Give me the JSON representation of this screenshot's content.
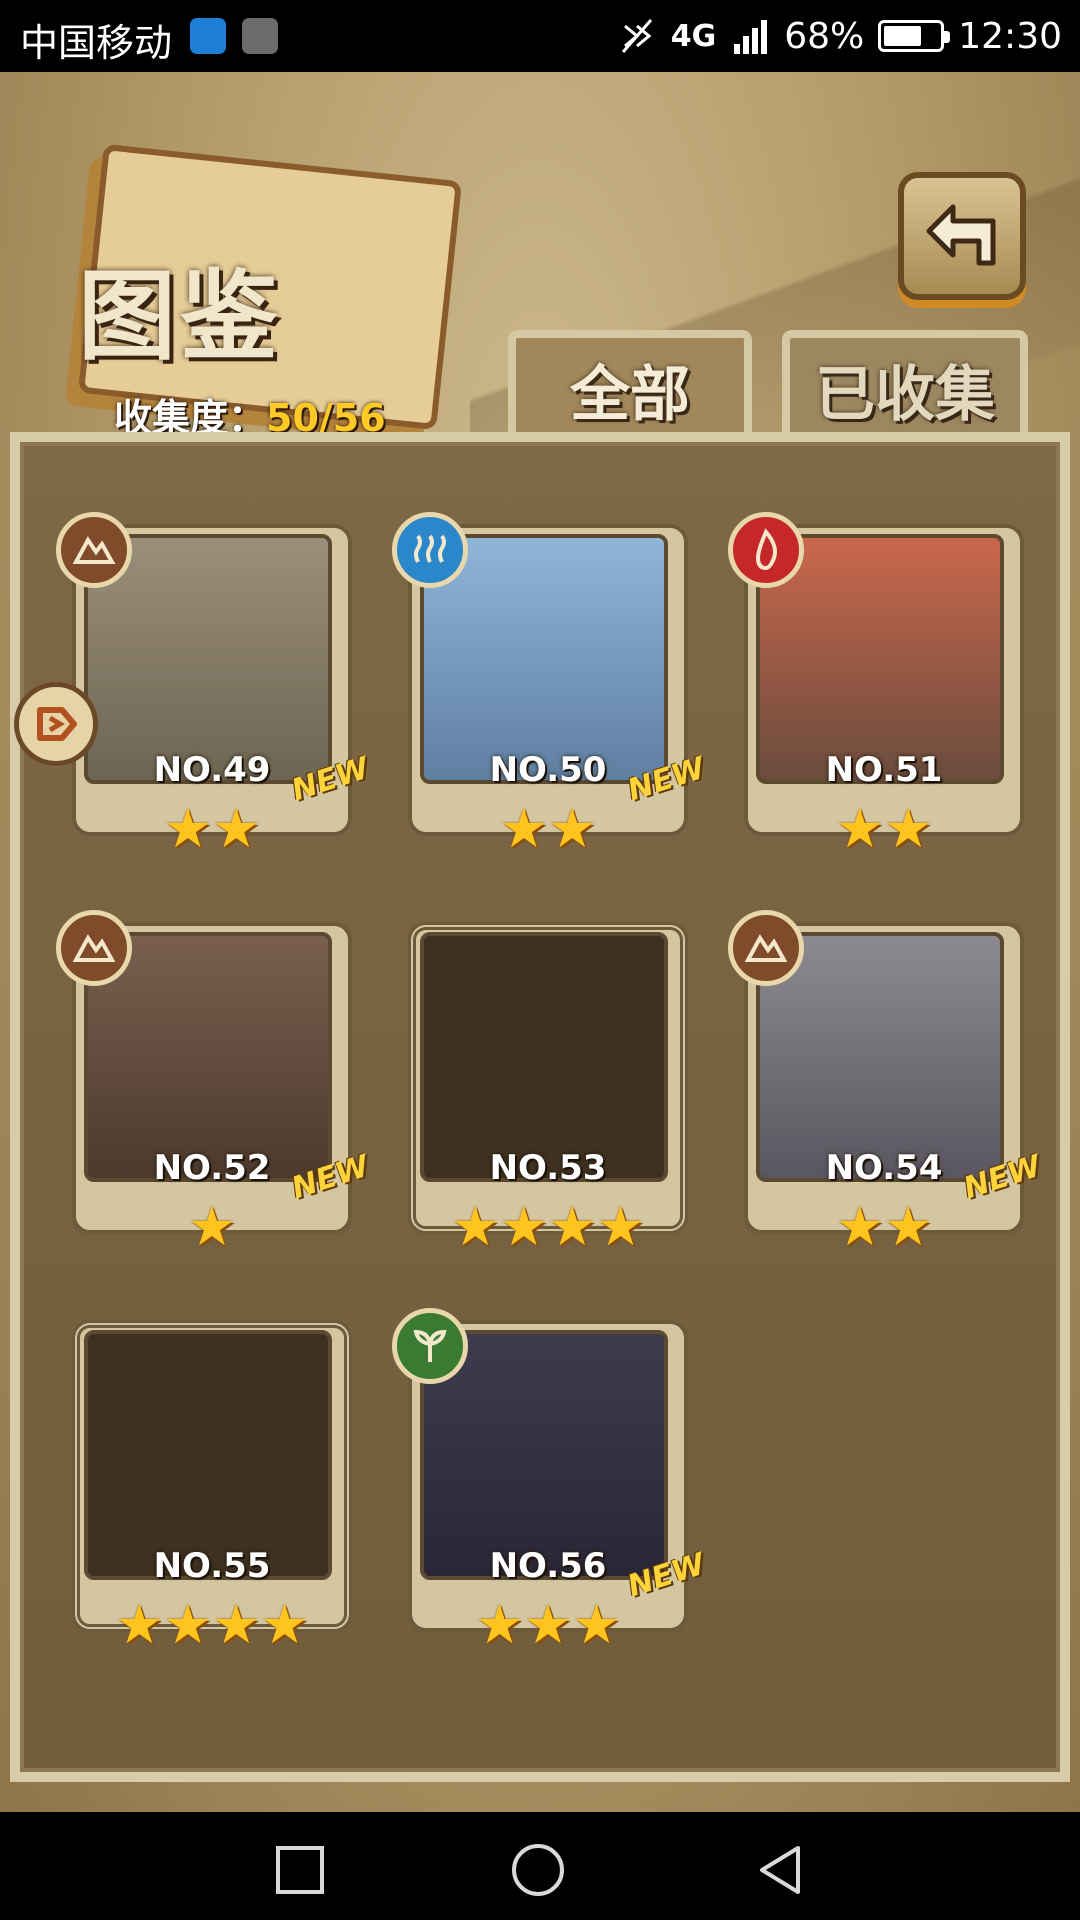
{
  "status_bar": {
    "carrier": "中国移动",
    "network": "4G",
    "battery_percent": "68%",
    "battery_level": 0.68,
    "time": "12:30"
  },
  "header": {
    "title": "图鉴",
    "collection_label": "收集度：",
    "collection_value": "50/56"
  },
  "tabs": [
    {
      "label": "全部",
      "selected": true
    },
    {
      "label": "已收集",
      "selected": false
    }
  ],
  "cards": [
    {
      "number": "NO.49",
      "stars": 2,
      "element": "earth-icon",
      "is_new": true,
      "collected": true
    },
    {
      "number": "NO.50",
      "stars": 2,
      "element": "water-icon",
      "is_new": true,
      "collected": true
    },
    {
      "number": "NO.51",
      "stars": 2,
      "element": "fire-icon",
      "is_new": false,
      "collected": true
    },
    {
      "number": "NO.52",
      "stars": 1,
      "element": "earth-icon",
      "is_new": true,
      "collected": true
    },
    {
      "number": "NO.53",
      "stars": 4,
      "element": "",
      "is_new": false,
      "collected": false
    },
    {
      "number": "NO.54",
      "stars": 2,
      "element": "earth-icon",
      "is_new": true,
      "collected": true
    },
    {
      "number": "NO.55",
      "stars": 4,
      "element": "",
      "is_new": false,
      "collected": false
    },
    {
      "number": "NO.56",
      "stars": 3,
      "element": "plant-icon",
      "is_new": true,
      "collected": true
    }
  ],
  "new_label": "NEW",
  "colors": {
    "accent_gold": "#ffc926",
    "panel_brown": "#7e6846",
    "frame_cream": "#d7cba8"
  }
}
